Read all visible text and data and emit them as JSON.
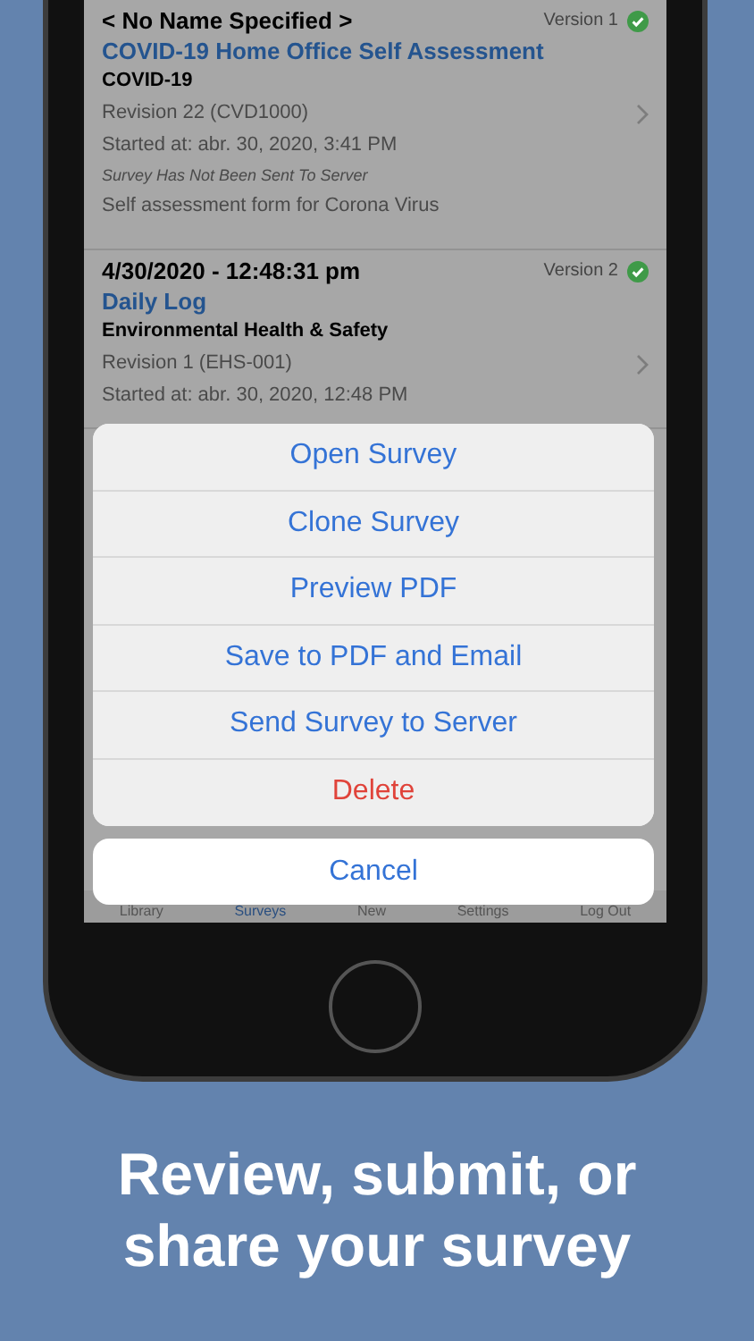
{
  "surveys": [
    {
      "name": "< No Name Specified >",
      "version": "Version 1",
      "synced": true,
      "title": "COVID-19 Home Office Self Assessment",
      "category": "COVID-19",
      "revision": "Revision 22 (CVD1000)",
      "started": "Started at: abr. 30, 2020, 3:41 PM",
      "status": "Survey Has Not Been Sent To Server",
      "description": "Self assessment form for Corona Virus"
    },
    {
      "name": "4/30/2020 - 12:48:31 pm",
      "version": "Version 2",
      "synced": true,
      "title": "Daily Log",
      "category": "Environmental Health & Safety",
      "revision": "Revision 1 (EHS-001)",
      "started": "Started at: abr. 30, 2020, 12:48 PM"
    }
  ],
  "tab_bar": [
    {
      "label": "Library",
      "selected": false
    },
    {
      "label": "Surveys",
      "selected": true
    },
    {
      "label": "New",
      "selected": false
    },
    {
      "label": "Settings",
      "selected": false
    },
    {
      "label": "Log Out",
      "selected": false
    }
  ],
  "action_sheet": {
    "actions": [
      {
        "label": "Open Survey",
        "kind": "default"
      },
      {
        "label": "Clone Survey",
        "kind": "default"
      },
      {
        "label": "Preview PDF",
        "kind": "default"
      },
      {
        "label": "Save to PDF and Email",
        "kind": "default"
      },
      {
        "label": "Send Survey to Server",
        "kind": "default"
      },
      {
        "label": "Delete",
        "kind": "destructive"
      }
    ],
    "cancel": "Cancel"
  },
  "caption": "Review, submit, or share your survey"
}
